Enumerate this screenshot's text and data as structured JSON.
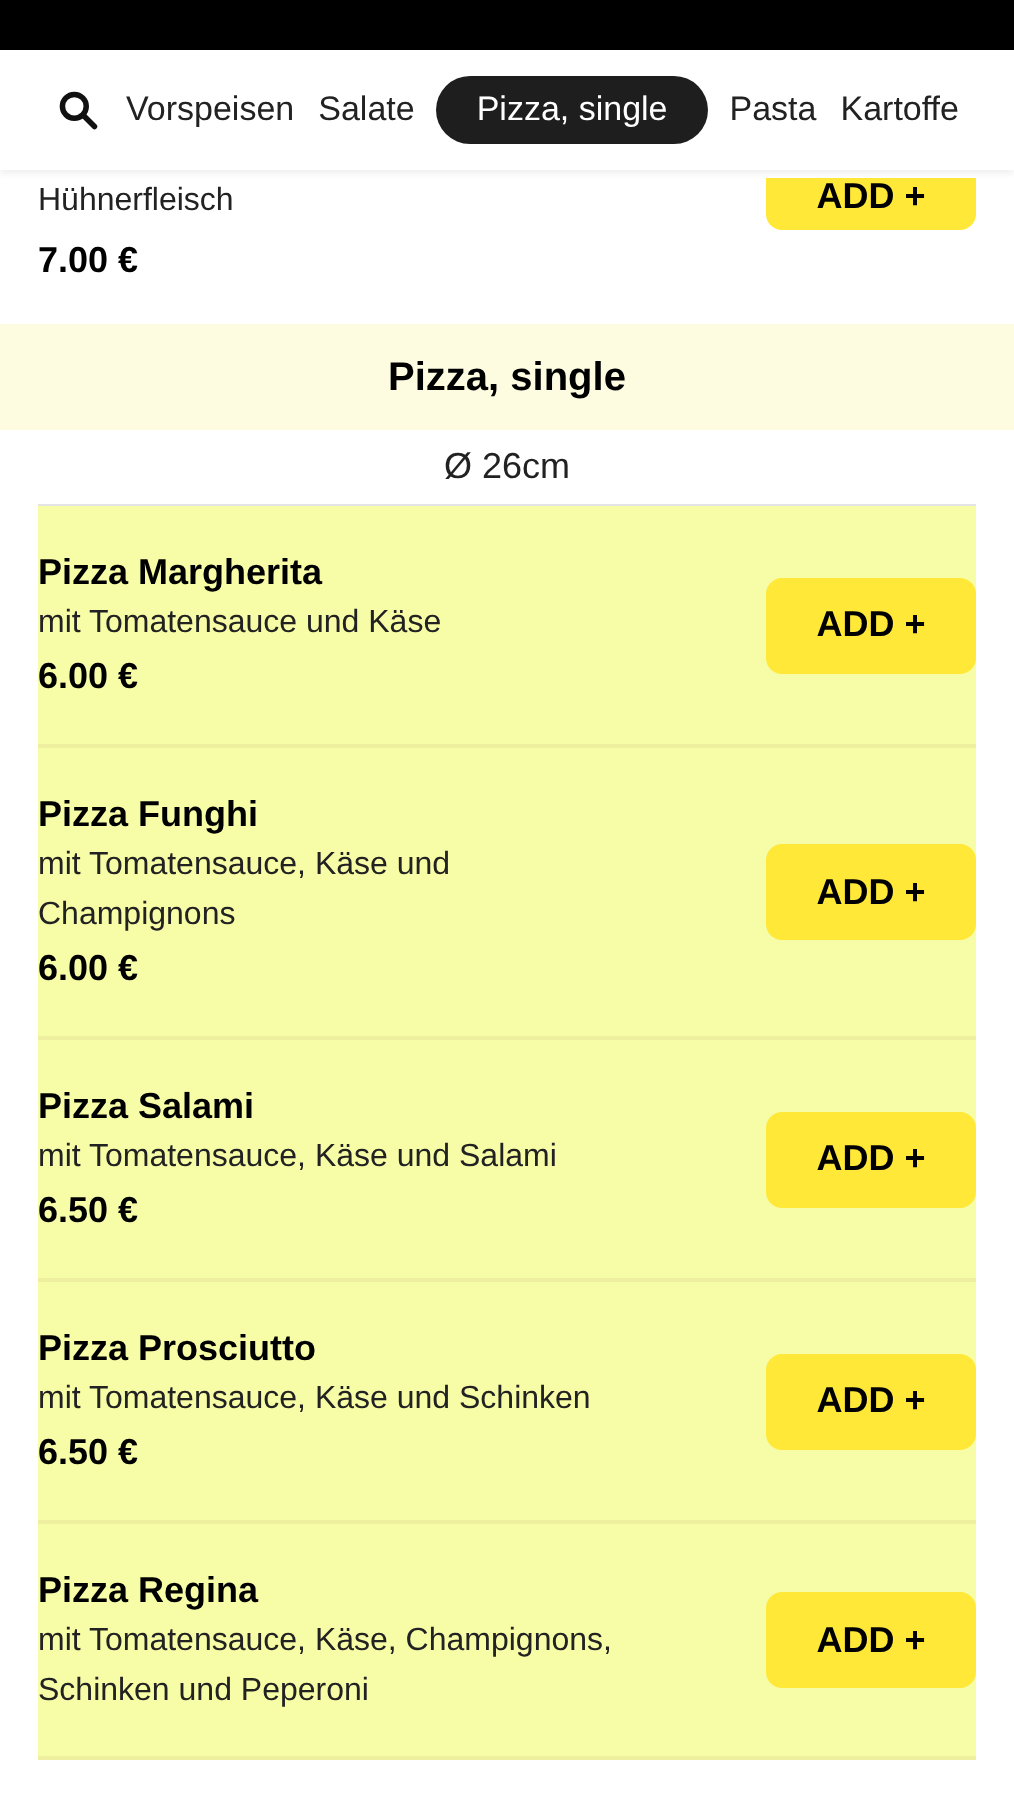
{
  "tabs": [
    {
      "label": "Vorspeisen",
      "selected": false
    },
    {
      "label": "Salate",
      "selected": false
    },
    {
      "label": "Pizza, single",
      "selected": true
    },
    {
      "label": "Pasta",
      "selected": false
    },
    {
      "label": "Kartoffe",
      "selected": false
    }
  ],
  "previous_item": {
    "description": "Hühnerfleisch",
    "price": "7.00 €",
    "button": "ADD +"
  },
  "section": {
    "title": "Pizza, single",
    "subtitle": "Ø 26cm"
  },
  "items": [
    {
      "name": "Pizza Margherita",
      "description": "mit Tomatensauce und Käse",
      "price": "6.00 €",
      "button": "ADD +"
    },
    {
      "name": "Pizza Funghi",
      "description": "mit Tomatensauce, Käse und Champignons",
      "price": "6.00 €",
      "button": "ADD +"
    },
    {
      "name": "Pizza Salami",
      "description": "mit Tomatensauce, Käse und Salami",
      "price": "6.50 €",
      "button": "ADD +"
    },
    {
      "name": "Pizza Prosciutto",
      "description": "mit Tomatensauce, Käse und Schinken",
      "price": "6.50 €",
      "button": "ADD +"
    },
    {
      "name": "Pizza Regina",
      "description": "mit Tomatensauce, Käse, Champignons, Schinken und Peperoni",
      "button": "ADD +"
    }
  ]
}
